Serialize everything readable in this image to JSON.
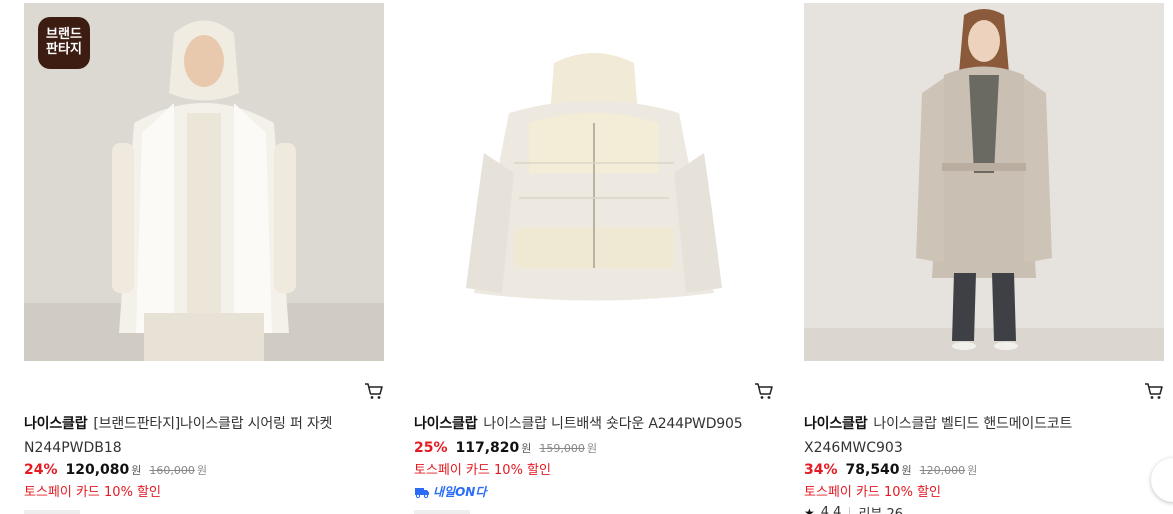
{
  "products": [
    {
      "brand": "나이스클랍",
      "name": "[브랜드판타지]나이스클랍 시어링 퍼 자켓",
      "code": "N244PWDB18",
      "discount": "24%",
      "price": "120,080",
      "currency": "원",
      "original_price": "160,000",
      "promo": "토스페이 카드 10% 할인",
      "badge": {
        "line1": "브랜드",
        "line2": "판타지"
      }
    },
    {
      "brand": "나이스클랍",
      "name": "나이스클랍 니트배색 숏다운 A244PWD905",
      "discount": "25%",
      "price": "117,820",
      "currency": "원",
      "original_price": "159,000",
      "promo": "토스페이 카드 10% 할인",
      "delivery_badge": "내일ON다"
    },
    {
      "brand": "나이스클랍",
      "name": "나이스클랍 벨티드 핸드메이드코트",
      "code": "X246MWC903",
      "discount": "34%",
      "price": "78,540",
      "currency": "원",
      "original_price": "120,000",
      "promo": "토스페이 카드 10% 할인",
      "rating": "4.4",
      "reviews": "리뷰 26"
    }
  ],
  "icons": {
    "cart": "cart-icon",
    "star": "star-icon",
    "delivery": "lightning-truck-icon"
  },
  "colors": {
    "discount": "#e31b23",
    "promo": "#e31b23",
    "delivery": "#2b6cf6",
    "badge_bg": "#3d1d12"
  }
}
